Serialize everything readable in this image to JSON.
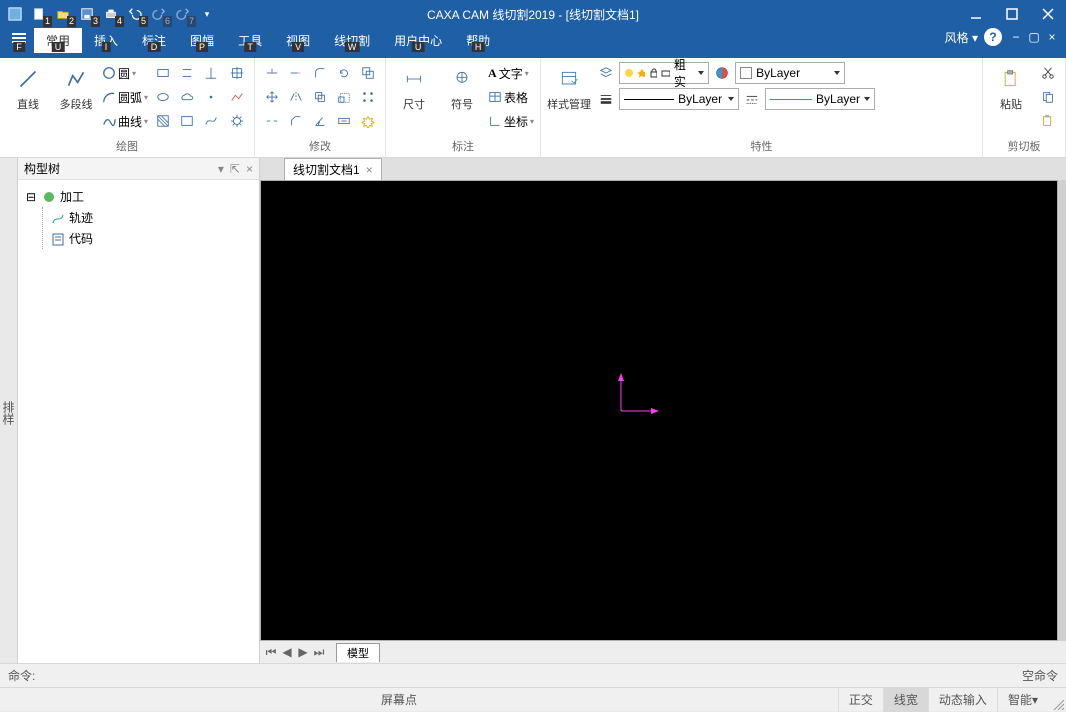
{
  "title": "CAXA CAM 线切割2019 - [线切割文档1]",
  "qat_nums": [
    "1",
    "2",
    "3",
    "4",
    "5",
    "6",
    "7"
  ],
  "menu": {
    "file": "F",
    "tabs": [
      {
        "label": "常用",
        "hint": "U",
        "active": true
      },
      {
        "label": "插入",
        "hint": "I"
      },
      {
        "label": "标注",
        "hint": "D"
      },
      {
        "label": "图幅",
        "hint": "P"
      },
      {
        "label": "工具",
        "hint": "T"
      },
      {
        "label": "视图",
        "hint": "V"
      },
      {
        "label": "线切割",
        "hint": "W"
      },
      {
        "label": "用户中心",
        "hint": "U"
      },
      {
        "label": "帮助",
        "hint": "H"
      }
    ],
    "style": "风格",
    "styleDrop": "▾"
  },
  "ribbon": {
    "draw": {
      "line": "直线",
      "polyline": "多段线",
      "arc": "圆弧",
      "circle": "圆",
      "curve": "曲线",
      "group_label": "绘图"
    },
    "modify": {
      "group_label": "修改"
    },
    "annotate": {
      "dim": "尺寸",
      "text": "文字",
      "symbol": "符号",
      "table": "表格",
      "coord": "坐标",
      "group_label": "标注"
    },
    "props": {
      "style_mgr": "样式管理",
      "linetype": "粗实",
      "bylayer": "ByLayer",
      "bylayer2": "ByLayer",
      "bylayer3": "ByLayer",
      "group_label": "特性"
    },
    "clip": {
      "paste": "粘贴",
      "group_label": "剪切板"
    }
  },
  "tree": {
    "title": "构型树",
    "root": "加工",
    "child1": "轨迹",
    "child2": "代码"
  },
  "left_strip_label": "排样",
  "doc": {
    "name": "线切割文档1"
  },
  "nav": {
    "model": "模型"
  },
  "cmd": {
    "prompt": "命令:",
    "idle": "空命令"
  },
  "status": {
    "screen_pt": "屏幕点",
    "ortho": "正交",
    "lineweight": "线宽",
    "dyninput": "动态输入",
    "smart": "智能"
  }
}
